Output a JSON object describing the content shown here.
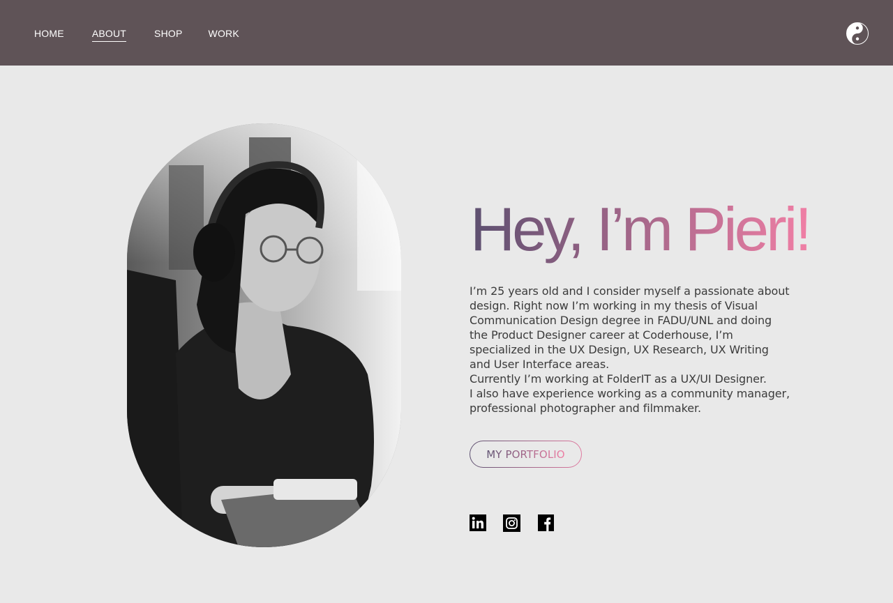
{
  "nav": {
    "items": [
      {
        "label": "HOME",
        "active": false
      },
      {
        "label": "ABOUT",
        "active": true
      },
      {
        "label": "SHOP",
        "active": false
      },
      {
        "label": "WORK",
        "active": false
      }
    ],
    "logo_icon": "yin-yang-icon"
  },
  "hero": {
    "headline": "Hey, I’m Pieri!",
    "gradient_start": "#5d5070",
    "gradient_end": "#f07fa5",
    "bio": [
      "I’m 25 years old and I consider myself a passionate about design. Right now I’m working in my thesis of Visual Communication Design degree in FADU/UNL and doing the Product Designer career at Coderhouse, I’m specialized in the UX Design, UX Research, UX Writing and User Interface areas.",
      "Currently I’m working at FolderIT as a UX/UI Designer.",
      "I also have experience working as a community manager, professional photographer and filmmaker."
    ],
    "button_label": "MY PORTFOLIO",
    "social": [
      "linkedin-icon",
      "instagram-icon",
      "facebook-icon"
    ]
  },
  "colors": {
    "topbar": "#5f5357",
    "background": "#e9e9e9",
    "text": "#3b3b3b"
  }
}
